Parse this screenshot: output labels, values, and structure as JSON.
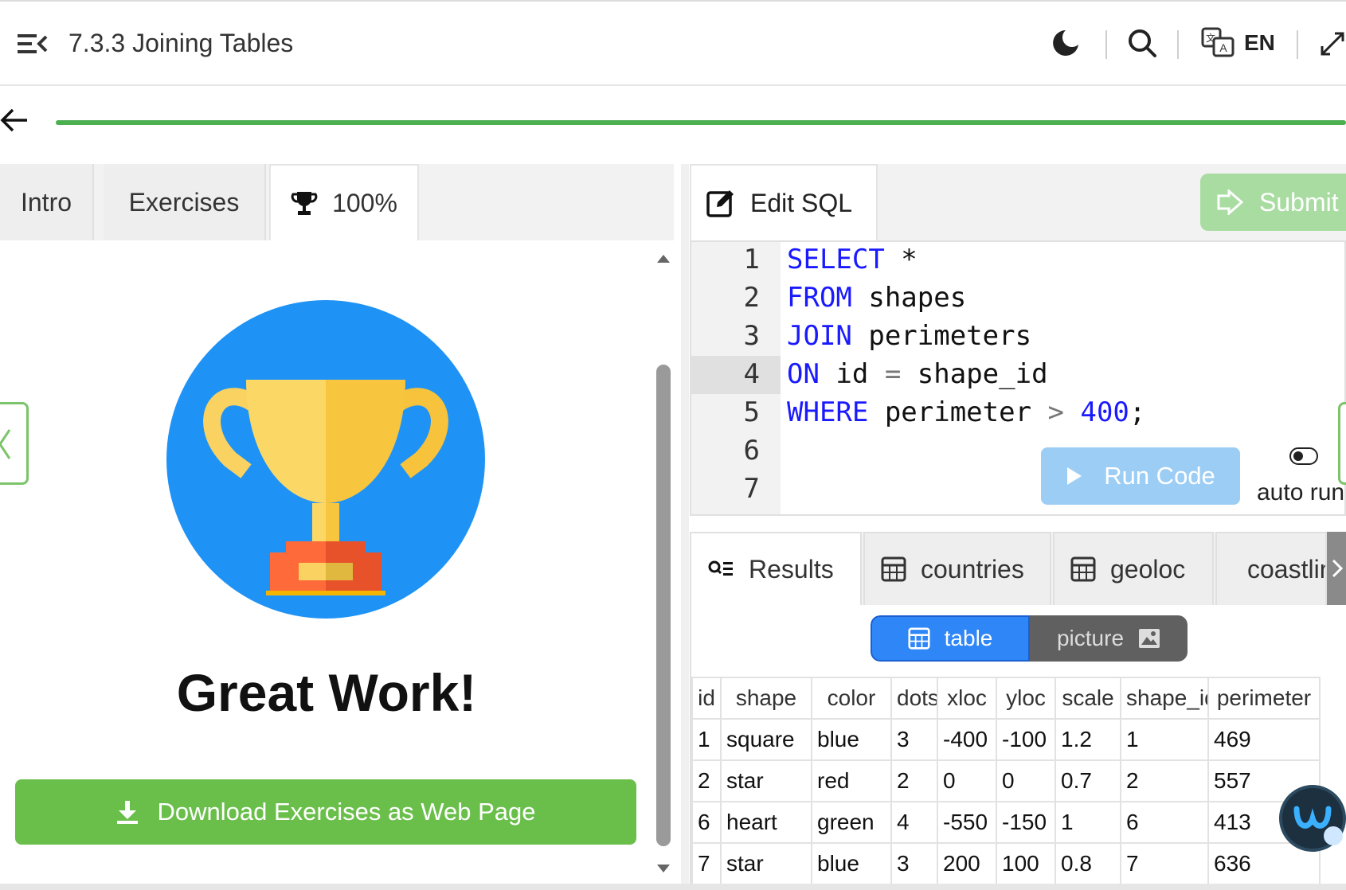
{
  "header": {
    "title": "7.3.3 Joining Tables",
    "language": "EN"
  },
  "progress": {
    "value": 100
  },
  "left_panel": {
    "tabs": [
      {
        "label": "Intro"
      },
      {
        "label": "Exercises"
      },
      {
        "label": "100%"
      }
    ],
    "heading": "Great Work!",
    "download_button": "Download Exercises as Web Page"
  },
  "editor": {
    "tab_label": "Edit SQL",
    "submit_label": "Submit",
    "line_numbers": [
      "1",
      "2",
      "3",
      "4",
      "5",
      "6",
      "7"
    ],
    "lines": [
      {
        "kw": "SELECT",
        "rest": " *"
      },
      {
        "kw": "FROM",
        "rest": " shapes"
      },
      {
        "kw": "JOIN",
        "rest": " perimeters"
      },
      {
        "kw": "ON",
        "rest": " id ",
        "op": "=",
        "rest2": " shape_id"
      },
      {
        "kw": "WHERE",
        "rest": " perimeter ",
        "op": ">",
        "num": " 400",
        "end": ";"
      }
    ],
    "run_label": "Run Code",
    "auto_run_label": "auto run"
  },
  "results": {
    "tabs": [
      {
        "label": "Results",
        "icon": "results-icon"
      },
      {
        "label": "countries",
        "icon": "table-icon"
      },
      {
        "label": "geoloc",
        "icon": "table-icon"
      },
      {
        "label": "coastline",
        "icon": "table-icon"
      }
    ],
    "view_table": "table",
    "view_picture": "picture",
    "columns": [
      "id",
      "shape",
      "color",
      "dots",
      "xloc",
      "yloc",
      "scale",
      "shape_id",
      "perimeter"
    ],
    "rows": [
      [
        "1",
        "square",
        "blue",
        "3",
        "-400",
        "-100",
        "1.2",
        "1",
        "469"
      ],
      [
        "2",
        "star",
        "red",
        "2",
        "0",
        "0",
        "0.7",
        "2",
        "557"
      ],
      [
        "6",
        "heart",
        "green",
        "4",
        "-550",
        "-150",
        "1",
        "6",
        "413"
      ],
      [
        "7",
        "star",
        "blue",
        "3",
        "200",
        "100",
        "0.8",
        "7",
        "636"
      ]
    ]
  },
  "colors": {
    "progress": "#4caf50",
    "download": "#6abf4b",
    "keyword": "#1a1aff",
    "trophy_bg": "#1f93f5"
  }
}
